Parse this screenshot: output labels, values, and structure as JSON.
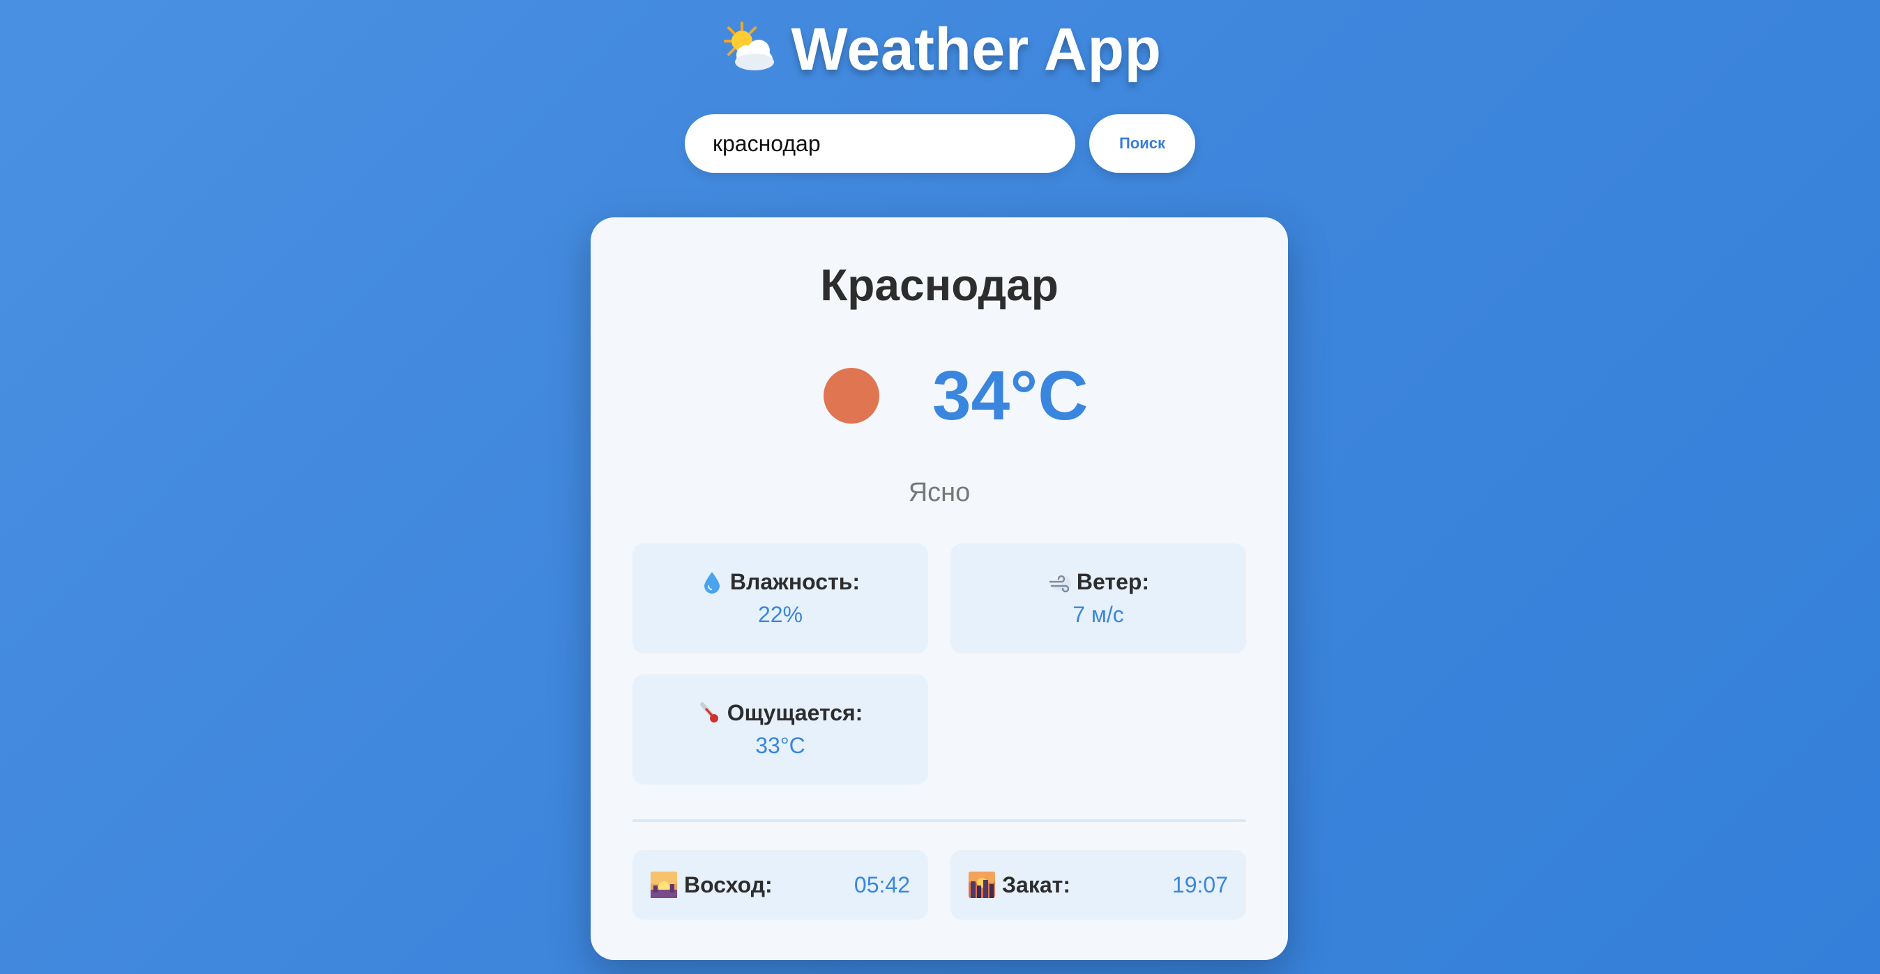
{
  "app": {
    "title": "Weather App",
    "title_icon": "sun-behind-cloud-icon"
  },
  "search": {
    "value": "краснодар",
    "button_label": "Поиск"
  },
  "weather": {
    "city": "Краснодар",
    "icon": "sun-icon",
    "icon_color": "#e07552",
    "temperature": "34°C",
    "description": "Ясно",
    "details": {
      "humidity": {
        "icon": "droplet-icon",
        "label": "Влажность:",
        "value": "22%"
      },
      "wind": {
        "icon": "wind-icon",
        "label": "Ветер:",
        "value": "7 м/с"
      },
      "feels_like": {
        "icon": "thermometer-icon",
        "label": "Ощущается:",
        "value": "33°C"
      }
    },
    "sun": {
      "sunrise": {
        "icon": "sunrise-icon",
        "label": "Восход:",
        "value": "05:42"
      },
      "sunset": {
        "icon": "sunset-icon",
        "label": "Закат:",
        "value": "19:07"
      }
    }
  },
  "colors": {
    "background": "#4a90e2",
    "accent": "#3a86de",
    "card": "#f4f8fc",
    "detail_box": "#e6f1fb"
  }
}
